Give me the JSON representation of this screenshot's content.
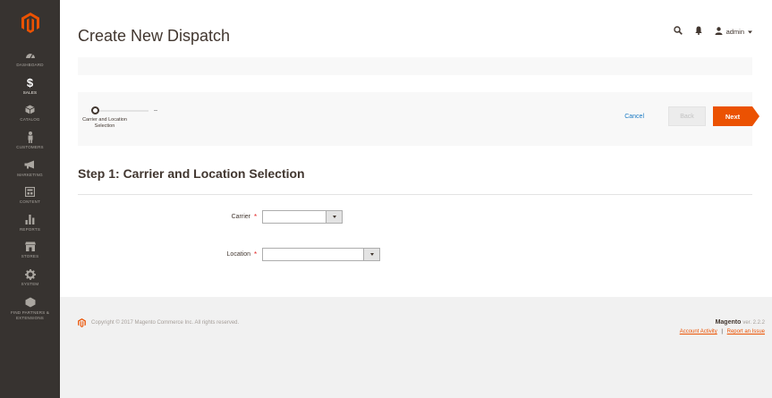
{
  "sidebar": {
    "items": [
      {
        "icon": "dashboard-icon",
        "label": "Dashboard"
      },
      {
        "icon": "dollar-icon",
        "label": "Sales"
      },
      {
        "icon": "catalog-cube-icon",
        "label": "Catalog"
      },
      {
        "icon": "customer-icon",
        "label": "Customers"
      },
      {
        "icon": "megaphone-icon",
        "label": "Marketing"
      },
      {
        "icon": "content-icon",
        "label": "Content"
      },
      {
        "icon": "bar-chart-icon",
        "label": "Reports"
      },
      {
        "icon": "store-icon",
        "label": "Stores"
      },
      {
        "icon": "gear-icon",
        "label": "System"
      },
      {
        "icon": "partners-icon",
        "label": "Find Partners & Extensions"
      }
    ],
    "active_index": 1
  },
  "header": {
    "title": "Create New Dispatch",
    "admin_label": "admin"
  },
  "wizard": {
    "step_label": "Carrier and Location Selection",
    "cancel_label": "Cancel",
    "back_label": "Back",
    "next_label": "Next"
  },
  "main": {
    "step_heading": "Step 1: Carrier and Location Selection",
    "fields": {
      "carrier_label": "Carrier",
      "carrier_value": "",
      "location_label": "Location",
      "location_value": ""
    }
  },
  "footer": {
    "copyright": "Copyright © 2017 Magento Commerce Inc. All rights reserved.",
    "brand": "Magento",
    "version": "ver. 2.2.2",
    "account_activity": "Account Activity",
    "separator": "|",
    "report_issue": "Report an Issue"
  },
  "colors": {
    "sidebar": "#373330",
    "accent": "#eb5202",
    "link": "#1979c3"
  }
}
